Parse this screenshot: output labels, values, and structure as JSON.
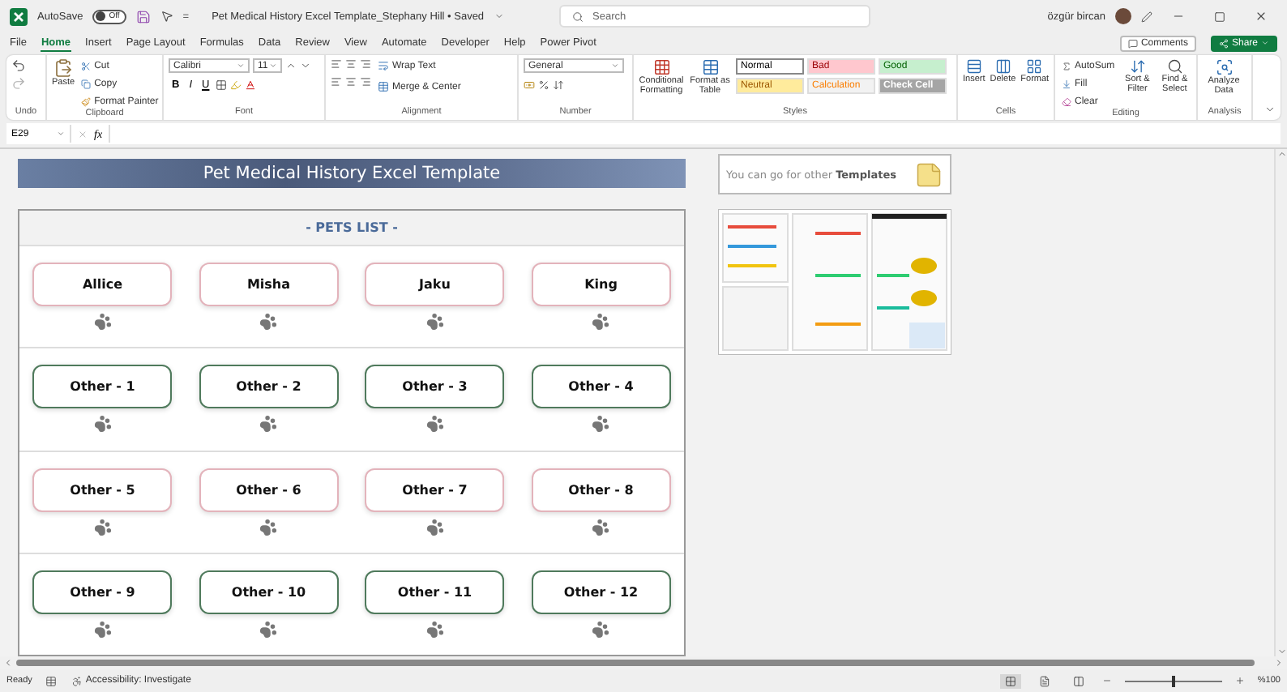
{
  "title_bar": {
    "autosave_label": "AutoSave",
    "autosave": {
      "on": false,
      "label": "Off"
    },
    "separator": "=",
    "document_title": "Pet Medical History Excel Template_Stephany Hill • Saved",
    "search": {
      "placeholder": "Search"
    },
    "user": "özgür bircan"
  },
  "ribbon_tabs": [
    {
      "label": "File",
      "selected": false
    },
    {
      "label": "Home",
      "selected": true
    },
    {
      "label": "Insert",
      "selected": false
    },
    {
      "label": "Page Layout",
      "selected": false
    },
    {
      "label": "Formulas",
      "selected": false
    },
    {
      "label": "Data",
      "selected": false
    },
    {
      "label": "Review",
      "selected": false
    },
    {
      "label": "View",
      "selected": false
    },
    {
      "label": "Automate",
      "selected": false
    },
    {
      "label": "Developer",
      "selected": false
    },
    {
      "label": "Help",
      "selected": false
    },
    {
      "label": "Power Pivot",
      "selected": false
    }
  ],
  "ribbon_actions": {
    "comments": "Comments",
    "share": "Share"
  },
  "ribbon": {
    "undo": {
      "label": "Undo"
    },
    "clipboard": {
      "label": "Clipboard",
      "paste": "Paste",
      "cut": "Cut",
      "copy": "Copy",
      "format_painter": "Format Painter"
    },
    "font": {
      "label": "Font",
      "name": "Calibri",
      "size": "11",
      "bold": "B",
      "italic": "I",
      "underline": "U"
    },
    "alignment": {
      "label": "Alignment",
      "wrap": "Wrap Text",
      "merge": "Merge & Center"
    },
    "number": {
      "label": "Number",
      "format": "General"
    },
    "styles": {
      "label": "Styles",
      "conditional": "Conditional Formatting",
      "format_table": "Format as Table",
      "cell_styles": [
        {
          "name": "Normal",
          "kind": "normal",
          "color": "#ffffff"
        },
        {
          "name": "Bad",
          "kind": "bad",
          "color": "#ffc7ce"
        },
        {
          "name": "Good",
          "kind": "good",
          "color": "#c6efce"
        },
        {
          "name": "Neutral",
          "kind": "neutral",
          "color": "#ffeb9c"
        },
        {
          "name": "Calculation",
          "kind": "calculation",
          "color": "#f2f2f2"
        },
        {
          "name": "Check Cell",
          "kind": "check",
          "color": "#a5a5a5"
        }
      ]
    },
    "cells": {
      "label": "Cells",
      "insert": "Insert",
      "delete": "Delete",
      "format": "Format"
    },
    "editing": {
      "label": "Editing",
      "autosum": "AutoSum",
      "fill": "Fill",
      "clear": "Clear",
      "sort": "Sort & Filter",
      "find": "Find & Select"
    },
    "analysis": {
      "label": "Analysis",
      "analyze": "Analyze Data"
    }
  },
  "formula_bar": {
    "name_box": "E29",
    "function_symbol": "fx"
  },
  "sheet": {
    "banner": "Pet Medical History Excel Template",
    "promo": "You can go for other **Templates**",
    "pets_list": {
      "heading": "- PETS LIST -",
      "rows": [
        {
          "color": "#e3b3bb",
          "pets": [
            "Allice",
            "Misha",
            "Jaku",
            "King"
          ]
        },
        {
          "color": "#4f7a5c",
          "pets": [
            "Other - 1",
            "Other - 2",
            "Other - 3",
            "Other - 4"
          ]
        },
        {
          "color": "#e3b3bb",
          "pets": [
            "Other - 5",
            "Other - 6",
            "Other - 7",
            "Other - 8"
          ]
        },
        {
          "color": "#4f7a5c",
          "pets": [
            "Other - 9",
            "Other - 10",
            "Other - 11",
            "Other - 12"
          ]
        }
      ]
    }
  },
  "status_bar": {
    "mode": "Ready",
    "accessibility": "Accessibility: Investigate",
    "views": [
      {
        "kind": "normal",
        "selected": true
      },
      {
        "kind": "page_layout",
        "selected": false
      },
      {
        "kind": "page_break",
        "selected": false
      }
    ],
    "zoom": {
      "level": 0.5,
      "label": "%100"
    }
  }
}
